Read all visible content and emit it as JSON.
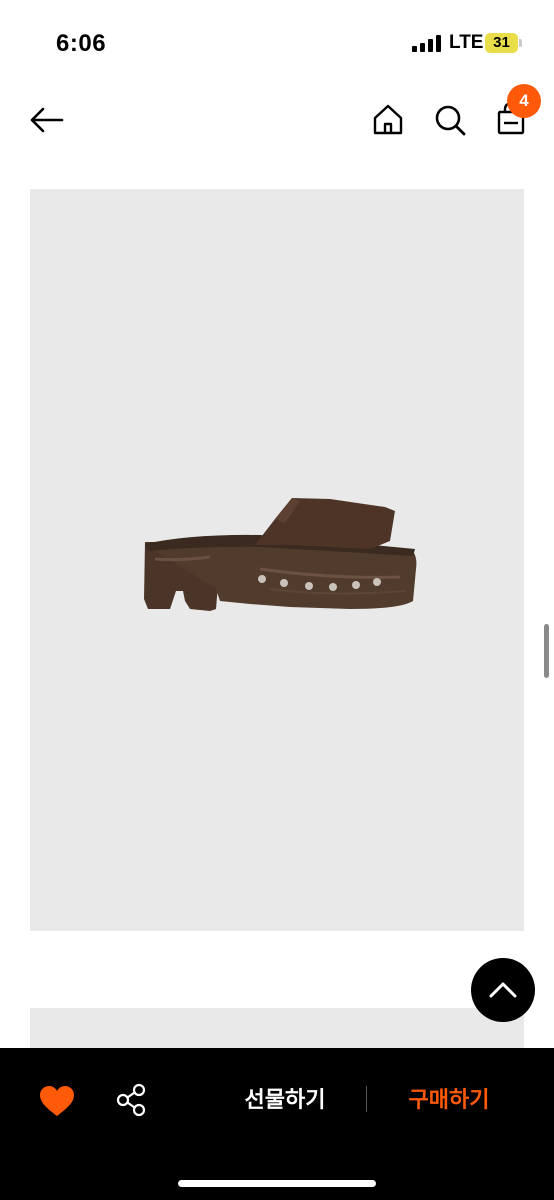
{
  "status_bar": {
    "time": "6:06",
    "network": "LTE",
    "battery_level": "31"
  },
  "header": {
    "icons": [
      "arrow-left-icon",
      "home-icon",
      "search-icon",
      "shopping-bag-icon"
    ],
    "cart_count": "4"
  },
  "product": {
    "image_subject": "brown suede slide sandal with wooden clog sole and metal studs"
  },
  "bottom_bar": {
    "gift_label": "선물하기",
    "buy_label": "구매하기",
    "icons": [
      "heart-icon",
      "share-icon"
    ]
  },
  "colors": {
    "accent": "#ff5a0a",
    "bar_background": "#000000",
    "image_background": "#e9e9e9",
    "battery": "#e9dd4a"
  }
}
